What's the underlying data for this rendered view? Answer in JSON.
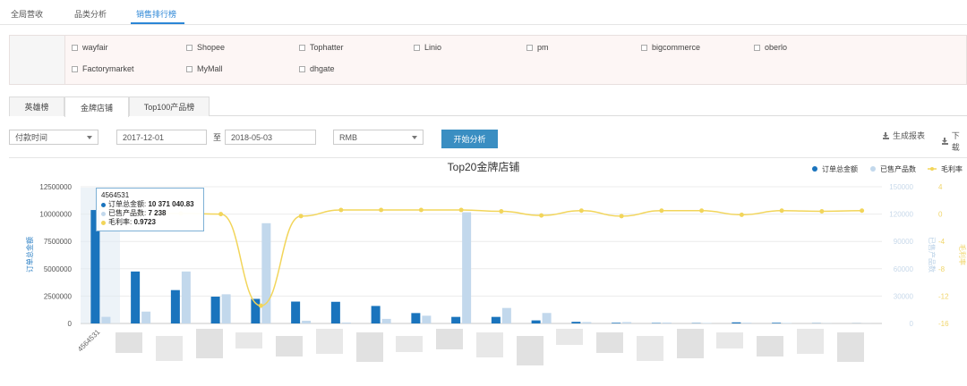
{
  "top_tabs": [
    {
      "label": "全局营收",
      "active": false
    },
    {
      "label": "品类分析",
      "active": false
    },
    {
      "label": "销售排行榜",
      "active": true
    }
  ],
  "platforms": [
    "wayfair",
    "Shopee",
    "Tophatter",
    "Linio",
    "pm",
    "bigcommerce",
    "oberlo",
    "Factorymarket",
    "MyMall",
    "dhgate"
  ],
  "sub_tabs": [
    {
      "label": "英雄榜",
      "active": false
    },
    {
      "label": "金牌店铺",
      "active": true
    },
    {
      "label": "Top100产品榜",
      "active": false
    }
  ],
  "controls": {
    "date_type": "付款时间",
    "start_date": "2017-12-01",
    "to_label": "至",
    "end_date": "2018-05-03",
    "currency": "RMB",
    "analyze_label": "开始分析",
    "report_label": "生成报表",
    "download_label": "下载"
  },
  "tooltip": {
    "header": "4564531",
    "amount_label": "订单总金额:",
    "amount_value": "10 371 040.83",
    "count_label": "已售产品数:",
    "count_value": "7 238",
    "margin_label": "毛利率:",
    "margin_value": "0.9723"
  },
  "colors": {
    "amount": "#1a74bd",
    "count": "#c2d8ec",
    "margin": "#f2d55a",
    "accent": "#2b86d6"
  },
  "chart_data": {
    "type": "bar",
    "title": "Top20金牌店铺",
    "legend": [
      "订单总金额",
      "已售产品数",
      "毛利率"
    ],
    "legend_position": "top-right",
    "ylabel_left": "订单总金额",
    "ylabel_right_1": "已售产品数",
    "ylabel_right_2": "毛利率",
    "y_left_ticks": [
      "0",
      "2500000",
      "5000000",
      "7500000",
      "10000000",
      "12500000"
    ],
    "y_right1_ticks": [
      "0",
      "30000",
      "60000",
      "90000",
      "120000",
      "150000"
    ],
    "y_right2_ticks": [
      "-16",
      "-12",
      "-8",
      "-4",
      "0",
      "4"
    ],
    "ylim_left": [
      0,
      12500000
    ],
    "ylim_right1": [
      0,
      150000
    ],
    "ylim_right2": [
      -16,
      4
    ],
    "first_category": "4564531",
    "amount": [
      10371040,
      4750000,
      3050000,
      2450000,
      2250000,
      2000000,
      1980000,
      1600000,
      950000,
      600000,
      600000,
      280000,
      150000,
      60000,
      40000,
      30000,
      100000,
      60000,
      20000,
      10000
    ],
    "products": [
      7238,
      13000,
      57000,
      32000,
      110000,
      3000,
      1000,
      5000,
      8500,
      122000,
      17000,
      11500,
      1500,
      1500,
      1000,
      500,
      800,
      500,
      200,
      100
    ],
    "margin": [
      0.97,
      0.1,
      0.1,
      0.0,
      -13.4,
      -0.3,
      0.6,
      0.6,
      0.6,
      0.6,
      0.4,
      -0.2,
      0.5,
      -0.3,
      0.5,
      0.5,
      -0.1,
      0.5,
      0.4,
      0.5
    ]
  }
}
